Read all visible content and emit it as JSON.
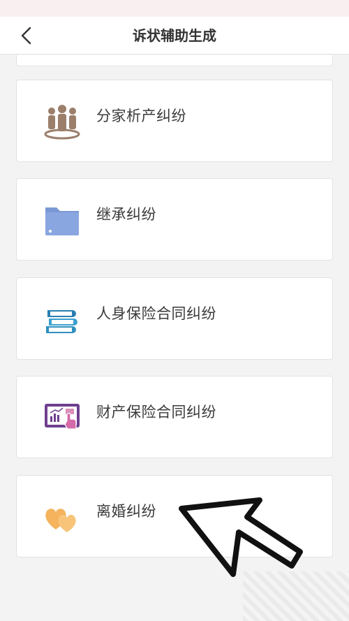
{
  "header": {
    "title": "诉状辅助生成"
  },
  "items": [
    {
      "label": "分家析产纠纷",
      "icon": "people-group-icon",
      "color": "#9b7f6b"
    },
    {
      "label": "继承纠纷",
      "icon": "folder-icon",
      "color": "#7b98d6"
    },
    {
      "label": "人身保险合同纠纷",
      "icon": "books-stack-icon",
      "color": "#2f8fbf"
    },
    {
      "label": "财产保险合同纠纷",
      "icon": "tablet-chart-icon",
      "color": "#6e3f8f"
    },
    {
      "label": "离婚纠纷",
      "icon": "two-hearts-icon",
      "color": "#f2b35a"
    }
  ]
}
